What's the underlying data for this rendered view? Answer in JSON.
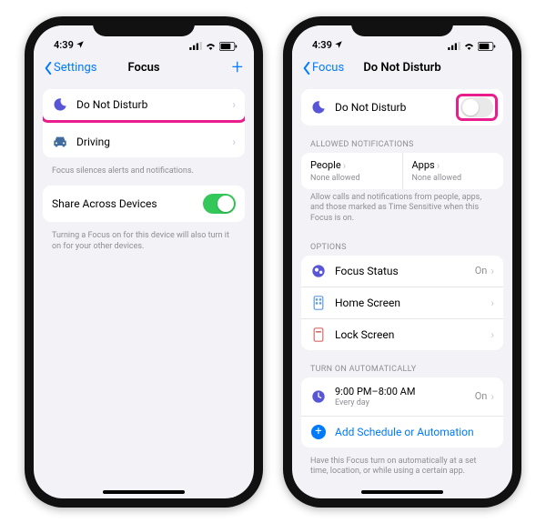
{
  "status": {
    "time": "4:39",
    "signal": "•••",
    "wifi": "wifi",
    "battery": "80"
  },
  "left": {
    "back": "Settings",
    "title": "Focus",
    "dnd": "Do Not Disturb",
    "driving": "Driving",
    "focus_footer": "Focus silences alerts and notifications.",
    "share": "Share Across Devices",
    "share_footer": "Turning a Focus on for this device will also turn it on for your other devices."
  },
  "right": {
    "back": "Focus",
    "title": "Do Not Disturb",
    "dnd": "Do Not Disturb",
    "allowed_header": "ALLOWED NOTIFICATIONS",
    "people": "People",
    "apps": "Apps",
    "none": "None allowed",
    "allowed_footer": "Allow calls and notifications from people, apps, and those marked as Time Sensitive when this Focus is on.",
    "options_header": "OPTIONS",
    "focus_status": "Focus Status",
    "focus_status_val": "On",
    "home_screen": "Home Screen",
    "lock_screen": "Lock Screen",
    "auto_header": "TURN ON AUTOMATICALLY",
    "schedule_time": "9:00 PM–8:00 AM",
    "schedule_sub": "Every day",
    "schedule_val": "On",
    "add_schedule": "Add Schedule or Automation",
    "auto_footer": "Have this Focus turn on automatically at a set time, location, or while using a certain app."
  }
}
